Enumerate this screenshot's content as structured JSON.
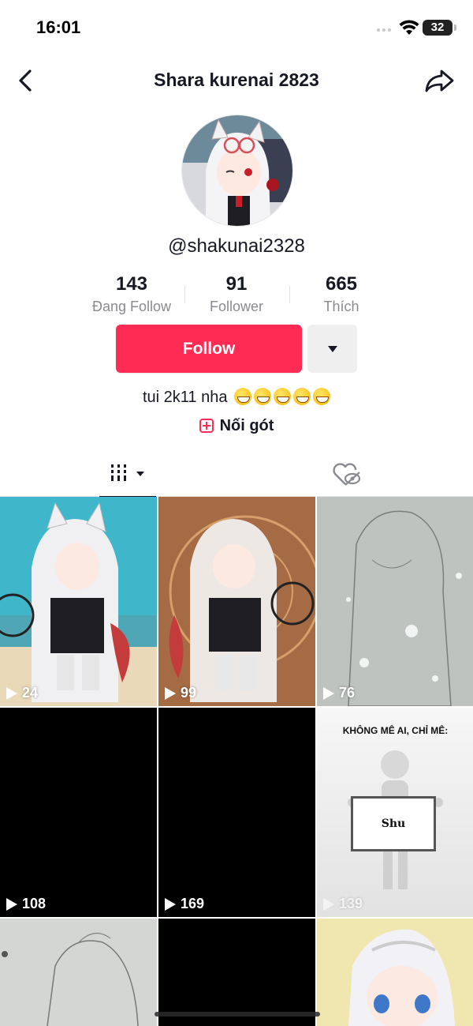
{
  "status_bar": {
    "time": "16:01",
    "battery": "32"
  },
  "header": {
    "title": "Shara kurenai 2823"
  },
  "profile": {
    "handle": "@shakunai2328",
    "stats": [
      {
        "value": "143",
        "label": "Đang Follow"
      },
      {
        "value": "91",
        "label": "Follower"
      },
      {
        "value": "665",
        "label": "Thích"
      }
    ],
    "follow_label": "Follow",
    "bio": "tui 2k11 nha",
    "bio_emoji": "grinning-face-icon",
    "link_label": "Nối gót"
  },
  "tabs": [
    {
      "name": "videos",
      "icon": "grid-icon"
    },
    {
      "name": "liked",
      "icon": "hidden-heart-icon"
    }
  ],
  "videos": [
    {
      "views": "24"
    },
    {
      "views": "99"
    },
    {
      "views": "76"
    },
    {
      "views": "108"
    },
    {
      "views": "169"
    },
    {
      "views": "139",
      "caption_top": "KHÔNG MÊ AI, CHỈ MÊ:",
      "caption_board": "Shu"
    },
    {
      "views": ""
    },
    {
      "views": ""
    },
    {
      "views": ""
    }
  ],
  "colors": {
    "accent": "#fe2c55",
    "text": "#161823",
    "muted": "#8a8b91"
  }
}
